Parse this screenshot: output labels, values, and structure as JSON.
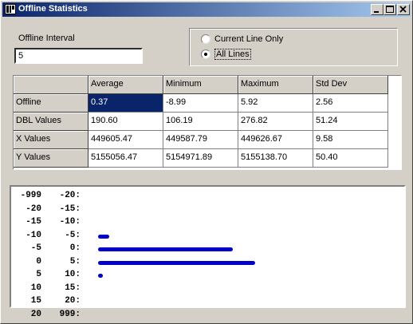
{
  "window": {
    "title": "Offline Statistics",
    "controls": [
      "minimize-icon",
      "maximize-icon",
      "close-icon"
    ]
  },
  "interval": {
    "label": "Offline Interval",
    "value": "5"
  },
  "mode": {
    "options": [
      {
        "label": "Current Line Only",
        "checked": false
      },
      {
        "label": "All Lines",
        "checked": true
      }
    ]
  },
  "stats": {
    "columns": [
      "",
      "Average",
      "Minimum",
      "Maximum",
      "Std Dev"
    ],
    "rows": [
      {
        "label": "Offline",
        "values": [
          "0.37",
          "-8.99",
          "5.92",
          "2.56"
        ]
      },
      {
        "label": "DBL Values",
        "values": [
          "190.60",
          "106.19",
          "276.82",
          "51.24"
        ]
      },
      {
        "label": "X Values",
        "values": [
          "449605.47",
          "449587.79",
          "449626.67",
          "9.58"
        ]
      },
      {
        "label": "Y Values",
        "values": [
          "5155056.47",
          "5154971.89",
          "5155138.70",
          "50.40"
        ]
      }
    ],
    "selected": {
      "row": 0,
      "col": 0
    }
  },
  "histogram": {
    "bar_color": "#0000cc",
    "bins": [
      {
        "lo": "-999",
        "hi": "-20:",
        "level": 0
      },
      {
        "lo": "-20",
        "hi": "-15:",
        "level": 0
      },
      {
        "lo": "-15",
        "hi": "-10:",
        "level": 0
      },
      {
        "lo": "-10",
        "hi": "-5:",
        "level": 0.07
      },
      {
        "lo": "-5",
        "hi": "0:",
        "level": 0.86
      },
      {
        "lo": "0",
        "hi": "5:",
        "level": 1.0
      },
      {
        "lo": "5",
        "hi": "10:",
        "level": 0.03
      },
      {
        "lo": "10",
        "hi": "15:",
        "level": 0
      },
      {
        "lo": "15",
        "hi": "20:",
        "level": 0
      },
      {
        "lo": "20",
        "hi": "999:",
        "level": 0
      }
    ]
  }
}
